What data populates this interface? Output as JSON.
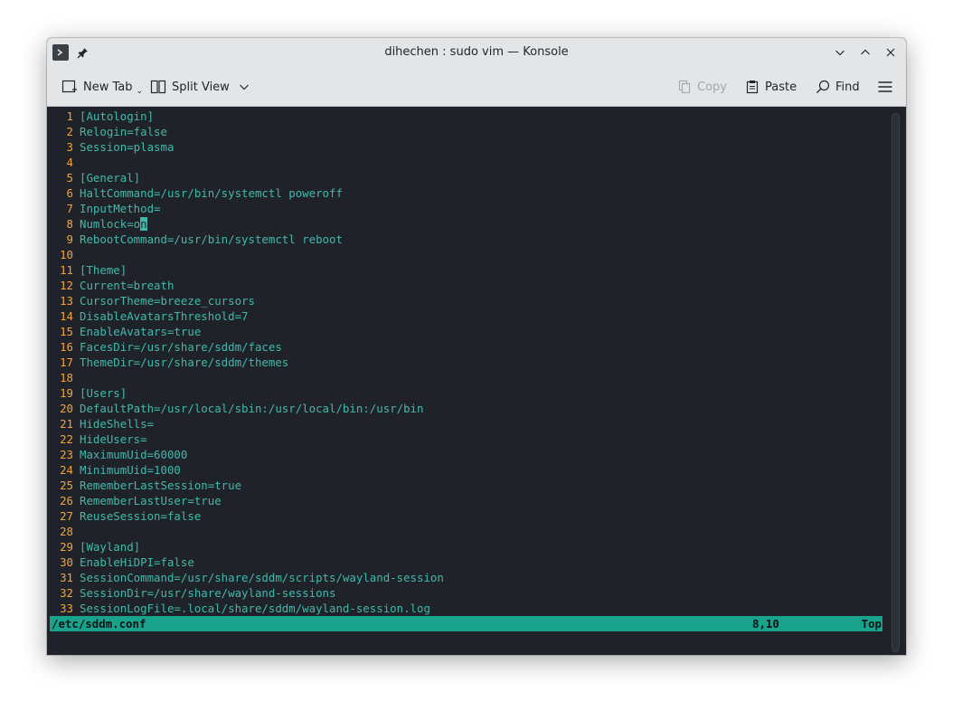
{
  "window": {
    "title": "dihechen : sudo vim — Konsole"
  },
  "toolbar": {
    "new_tab": "New Tab",
    "split_view": "Split View",
    "copy": "Copy",
    "paste": "Paste",
    "find": "Find"
  },
  "editor": {
    "lines": [
      {
        "n": "1",
        "t": "[Autologin]"
      },
      {
        "n": "2",
        "t": "Relogin=false"
      },
      {
        "n": "3",
        "t": "Session=plasma"
      },
      {
        "n": "4",
        "t": ""
      },
      {
        "n": "5",
        "t": "[General]"
      },
      {
        "n": "6",
        "t": "HaltCommand=/usr/bin/systemctl poweroff"
      },
      {
        "n": "7",
        "t": "InputMethod="
      },
      {
        "n": "8",
        "t": "Numlock=on"
      },
      {
        "n": "9",
        "t": "RebootCommand=/usr/bin/systemctl reboot"
      },
      {
        "n": "10",
        "t": ""
      },
      {
        "n": "11",
        "t": "[Theme]"
      },
      {
        "n": "12",
        "t": "Current=breath"
      },
      {
        "n": "13",
        "t": "CursorTheme=breeze_cursors"
      },
      {
        "n": "14",
        "t": "DisableAvatarsThreshold=7"
      },
      {
        "n": "15",
        "t": "EnableAvatars=true"
      },
      {
        "n": "16",
        "t": "FacesDir=/usr/share/sddm/faces"
      },
      {
        "n": "17",
        "t": "ThemeDir=/usr/share/sddm/themes"
      },
      {
        "n": "18",
        "t": ""
      },
      {
        "n": "19",
        "t": "[Users]"
      },
      {
        "n": "20",
        "t": "DefaultPath=/usr/local/sbin:/usr/local/bin:/usr/bin"
      },
      {
        "n": "21",
        "t": "HideShells="
      },
      {
        "n": "22",
        "t": "HideUsers="
      },
      {
        "n": "23",
        "t": "MaximumUid=60000"
      },
      {
        "n": "24",
        "t": "MinimumUid=1000"
      },
      {
        "n": "25",
        "t": "RememberLastSession=true"
      },
      {
        "n": "26",
        "t": "RememberLastUser=true"
      },
      {
        "n": "27",
        "t": "ReuseSession=false"
      },
      {
        "n": "28",
        "t": ""
      },
      {
        "n": "29",
        "t": "[Wayland]"
      },
      {
        "n": "30",
        "t": "EnableHiDPI=false"
      },
      {
        "n": "31",
        "t": "SessionCommand=/usr/share/sddm/scripts/wayland-session"
      },
      {
        "n": "32",
        "t": "SessionDir=/usr/share/wayland-sessions"
      },
      {
        "n": "33",
        "t": "SessionLogFile=.local/share/sddm/wayland-session.log"
      }
    ],
    "cursor_line": 8,
    "cursor_col": 10
  },
  "status": {
    "file": "/etc/sddm.conf",
    "position": "8,10",
    "scroll": "Top"
  },
  "colors": {
    "terminal_bg": "#1f2329",
    "text": "#41b9aa",
    "line_number": "#f2a33c",
    "status_bg": "#19a28c"
  },
  "icons": {
    "app": "konsole-app-icon",
    "pin": "pin-icon",
    "minimize": "chevron-down-icon",
    "maximize": "chevron-up-icon",
    "close": "close-icon",
    "new_tab": "new-tab-icon",
    "split_view": "split-view-icon",
    "copy": "copy-icon",
    "paste": "paste-icon",
    "find": "search-icon",
    "menu": "hamburger-menu-icon"
  }
}
